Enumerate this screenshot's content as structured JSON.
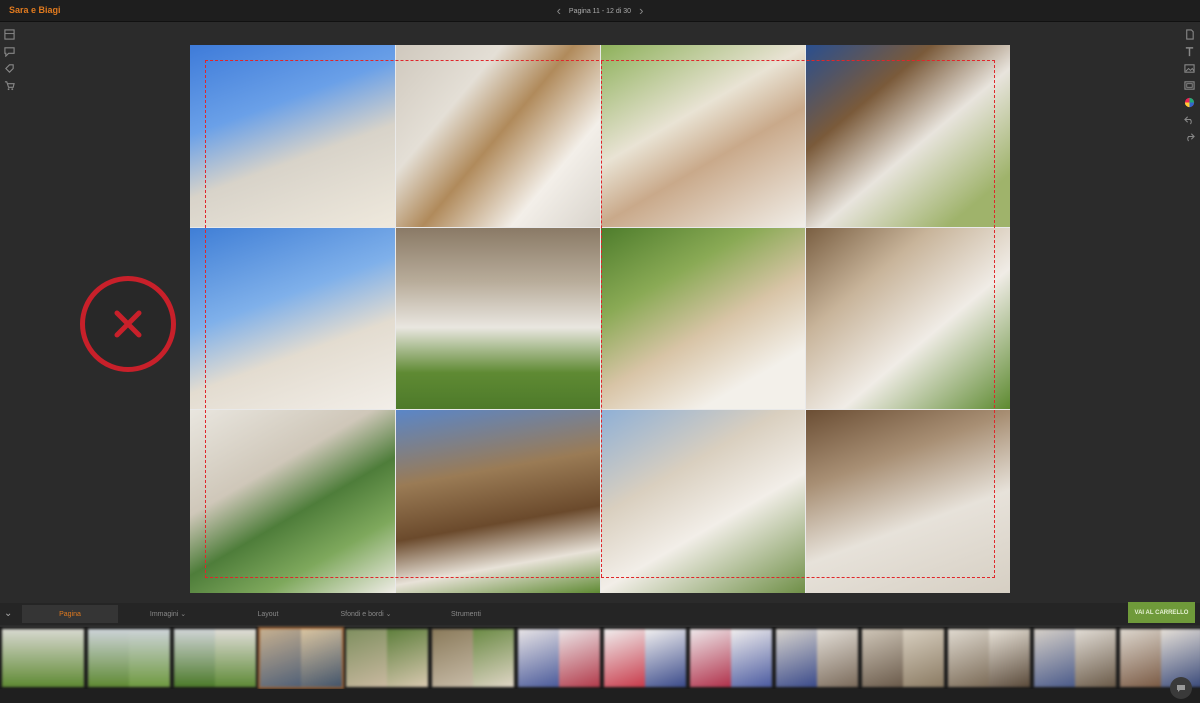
{
  "app": {
    "title": "Sara e Biagi"
  },
  "page_nav": {
    "label": "Pagina 11 - 12 di 30",
    "prev_icon": "chevron-left-icon",
    "next_icon": "chevron-right-icon"
  },
  "left_tools": [
    "layout-icon",
    "speech-bubble-icon",
    "tag-icon",
    "cart-icon"
  ],
  "right_tools": [
    "page-icon",
    "text-icon",
    "image-icon",
    "frame-icon",
    "color-palette-icon",
    "undo-icon",
    "redo-icon"
  ],
  "reject_icon": "reject-x-icon",
  "tabs": [
    {
      "label": "Pagina",
      "active": true
    },
    {
      "label": "Immagini ⌄",
      "active": false
    },
    {
      "label": "Layout",
      "active": false
    },
    {
      "label": "Sfondi e bordi ⌄",
      "active": false
    },
    {
      "label": "Strumenti",
      "active": false
    }
  ],
  "cart_button": {
    "label": "VAI AL CARRELLO"
  },
  "colors": {
    "accent": "#e07a1f",
    "reject": "#c8202a",
    "safe_line": "#e0262b",
    "cart": "#6f9a3a"
  },
  "photos": [
    {
      "name": "bride-groom-petals",
      "bg": "linear-gradient(160deg,#3e7bd9 0%,#6aa0e8 35%,#d8d3c9 60%,#efe9dd 100%)"
    },
    {
      "name": "bride-smile-closeup",
      "bg": "linear-gradient(130deg,#cfc8bd 0%,#e4dfd6 30%,#b08a5b 50%,#f3efe9 75%,#d9d4cc 100%)"
    },
    {
      "name": "couple-kiss-garden",
      "bg": "linear-gradient(150deg,#8db15a 0%,#e9e3d4 40%,#c9a98a 60%,#f1eee8 100%)"
    },
    {
      "name": "guests-speech",
      "bg": "linear-gradient(140deg,#2a4f8f 0%,#7a5a3a 30%,#e8e4dd 55%,#9fb36b 85%)"
    },
    {
      "name": "toast-sky",
      "bg": "linear-gradient(160deg,#3f7ed6 0%,#7fb0ea 40%,#e3dcd0 65%,#f2eee8 100%)"
    },
    {
      "name": "walking-aisle",
      "bg": "linear-gradient(180deg,#8a7a66 0%,#b9ad9b 30%,#e9e6e0 55%,#5f8a33 80%,#4d7a2a 100%)"
    },
    {
      "name": "bride-laughing-guests",
      "bg": "linear-gradient(150deg,#4e7d2c 0%,#8aaa55 30%,#d8c4a6 55%,#f3f0ea 80%)"
    },
    {
      "name": "bridesmaids",
      "bg": "linear-gradient(140deg,#7a5f42 0%,#c8b49a 30%,#f0ece6 60%,#5d8a30 100%)"
    },
    {
      "name": "bouquet-closeup",
      "bg": "linear-gradient(150deg,#e9e6df 0%,#cfc7b9 35%,#4e7d3a 55%,#7ea85c 75%,#efece6 100%)"
    },
    {
      "name": "ceremony-rustic",
      "bg": "linear-gradient(170deg,#5a86c8 0%,#9a7b55 35%,#6b4a2c 60%,#e8e2d8 80%,#5f8a33 100%)"
    },
    {
      "name": "altar-couple",
      "bg": "linear-gradient(150deg,#8fb0d6 0%,#d9cfbf 35%,#f2eee8 60%,#6f8f47 100%)"
    },
    {
      "name": "procession-guests",
      "bg": "linear-gradient(160deg,#6b4e34 0%,#a88f74 30%,#e7e2da 60%,#d6cfc3 100%)"
    }
  ],
  "thumbnails": [
    {
      "left_bg": "linear-gradient(180deg,#d8d8d0,#5f8a33)",
      "right_bg": "linear-gradient(180deg,#d8d8d0,#5f8a33)"
    },
    {
      "left_bg": "linear-gradient(180deg,#cdd3d8,#5f8a33)",
      "right_bg": "linear-gradient(180deg,#cdd3d8,#6f9a40)"
    },
    {
      "left_bg": "linear-gradient(180deg,#d0d4d6,#4c7a2a)",
      "right_bg": "linear-gradient(180deg,#e0ddd8,#5e8a36)"
    },
    {
      "left_bg": "linear-gradient(160deg,#b8a38a,#3b5a8a)",
      "right_bg": "linear-gradient(160deg,#c9b79a,#2e4f7d)"
    },
    {
      "left_bg": "linear-gradient(160deg,#7f8f5f,#c9b9a0)",
      "right_bg": "linear-gradient(160deg,#5e7f3c,#d8c8b0)"
    },
    {
      "left_bg": "linear-gradient(160deg,#8a7a5a,#c8bca8)",
      "right_bg": "linear-gradient(160deg,#6a8a44,#e0d6c6)"
    },
    {
      "left_bg": "linear-gradient(160deg,#e8e4e6,#4a5a9a)",
      "right_bg": "linear-gradient(160deg,#ece6e8,#b23a4a)"
    },
    {
      "left_bg": "linear-gradient(160deg,#f0eeee,#c83a4a)",
      "right_bg": "linear-gradient(160deg,#f2f0f0,#3a4a8a)"
    },
    {
      "left_bg": "linear-gradient(160deg,#eee8ea,#b0304a)",
      "right_bg": "linear-gradient(160deg,#f1eeee,#4a5aa0)"
    },
    {
      "left_bg": "linear-gradient(160deg,#d8d4ce,#3a4a8a)",
      "right_bg": "linear-gradient(160deg,#e4dfd8,#7a6a5a)"
    },
    {
      "left_bg": "linear-gradient(160deg,#cfc6b8,#6a5a4a)",
      "right_bg": "linear-gradient(160deg,#d8cfc0,#8a7a62)"
    },
    {
      "left_bg": "linear-gradient(160deg,#e0dad0,#7a6a56)",
      "right_bg": "linear-gradient(160deg,#e8e2d8,#5a4a3a)"
    },
    {
      "left_bg": "linear-gradient(160deg,#d6d0c8,#4a5a8a)",
      "right_bg": "linear-gradient(160deg,#e2ddd6,#6a5a48)"
    },
    {
      "left_bg": "linear-gradient(160deg,#ddd7ce,#7a5a44)",
      "right_bg": "linear-gradient(160deg,#e6e0d8,#3a4a7a)"
    }
  ],
  "selected_thumbnail": 3,
  "help_icon": "chat-help-icon"
}
